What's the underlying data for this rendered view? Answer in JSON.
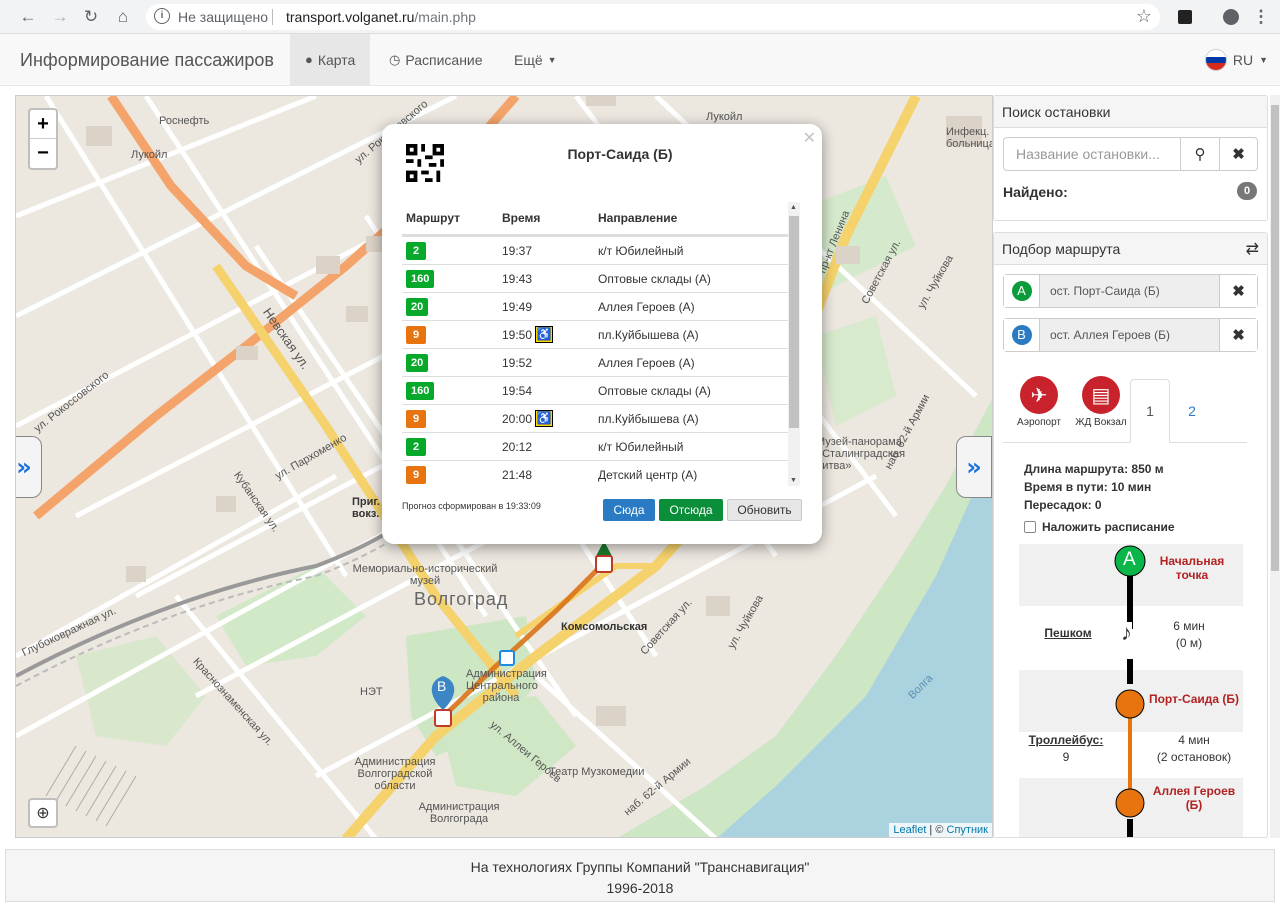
{
  "browser": {
    "security_label": "Не защищено",
    "url_host": "transport.volganet.ru",
    "url_path": "/main.php"
  },
  "nav": {
    "brand": "Информирование пассажиров",
    "map": "Карта",
    "schedule": "Расписание",
    "more": "Ещё",
    "lang": "RU"
  },
  "map": {
    "attribution_leaflet": "Leaflet",
    "attribution_sep": " | © ",
    "attribution_sputnik": "Спутник",
    "city": "Волгоград",
    "labels": {
      "rosneft": "Роснефть",
      "lukoil1": "Лукойл",
      "lukoil2": "Лукойл",
      "nevskaya": "Невская ул.",
      "rokossovskogo1": "ул. Рокоссовского",
      "rokossovskogo2": "ул. Рокоссовского",
      "komsomolskaya": "Комсомольская",
      "memorial": "Мемориально-исторический музей",
      "admin_center": "Администрация Центрального района",
      "admin_oblast": "Администрация Волгоградской области",
      "admin_city": "Администрация Волгограда",
      "teatr": "Театр Музкомедии",
      "net": "НЭТ",
      "nab62": "наб. 62-й Армии",
      "sovetskaya": "Советская ул.",
      "chuykova": "ул. Чуйкова",
      "lenina": "пр-кт Ленина",
      "volga": "Волга",
      "allei_geroev": "ул. Аллеи Героев",
      "kubanskaya": "Кубанская ул.",
      "parkhomenko": "ул. Пархоменко",
      "glubokovrazhnaya": "Глубоковражная ул.",
      "krasnoznamenskaya": "Краснознаменская ул.",
      "infect": "Инфекц. больница",
      "panorama": "Музей-панорама «Сталинградская битва»",
      "prig_vokzal": "Приг. вокз.",
      "marker_b": "B"
    }
  },
  "popup": {
    "title": "Порт-Саида (Б)",
    "columns": [
      "Маршрут",
      "Время",
      "Направление"
    ],
    "rows": [
      {
        "route": "2",
        "color": "#07a92a",
        "time": "19:37",
        "dir": "к/т Юбилейный",
        "wc": false
      },
      {
        "route": "160",
        "color": "#07a92a",
        "time": "19:43",
        "dir": "Оптовые склады (А)",
        "wc": false
      },
      {
        "route": "20",
        "color": "#07a92a",
        "time": "19:49",
        "dir": "Аллея Героев (А)",
        "wc": false
      },
      {
        "route": "9",
        "color": "#e8740f",
        "time": "19:50",
        "dir": "пл.Куйбышева (А)",
        "wc": true
      },
      {
        "route": "20",
        "color": "#07a92a",
        "time": "19:52",
        "dir": "Аллея Героев (А)",
        "wc": false
      },
      {
        "route": "160",
        "color": "#07a92a",
        "time": "19:54",
        "dir": "Оптовые склады (А)",
        "wc": false
      },
      {
        "route": "9",
        "color": "#e8740f",
        "time": "20:00",
        "dir": "пл.Куйбышева (А)",
        "wc": true
      },
      {
        "route": "2",
        "color": "#07a92a",
        "time": "20:12",
        "dir": "к/т Юбилейный",
        "wc": false
      },
      {
        "route": "9",
        "color": "#e8740f",
        "time": "21:48",
        "dir": "Детский центр (А)",
        "wc": false
      }
    ],
    "forecast": "Прогноз сформирован в 19:33:09",
    "btn_to": "Сюда",
    "btn_from": "Отсюда",
    "btn_refresh": "Обновить"
  },
  "stop_search": {
    "header": "Поиск остановки",
    "placeholder": "Название остановки...",
    "found_label": "Найдено:",
    "found_count": "0"
  },
  "route_pick": {
    "header": "Подбор маршрута",
    "point_a_letter": "A",
    "point_a": "ост. Порт-Саида (Б)",
    "point_b_letter": "B",
    "point_b": "ост. Аллея Героев (Б)",
    "quick_airport": "Аэропорт",
    "quick_station": "ЖД Вокзал",
    "tab1": "1",
    "tab2": "2",
    "length": "Длина маршрута: 850 м",
    "duration": "Время в пути: 10 мин",
    "transfers": "Пересадок: 0",
    "overlay_schedule": "Наложить расписание",
    "start_label": "Начальная точка",
    "walk_label": "Пешком",
    "walk_time": "6 мин",
    "walk_dist": "(0 м)",
    "stop1": "Порт-Саида (Б)",
    "transport_label": "Троллейбус:",
    "transport_route": "9",
    "transport_time": "4 мин",
    "transport_stops": "(2 остановок)",
    "stop2": "Аллея Героев (Б)"
  },
  "footer": {
    "line1": "На технологиях Группы Компаний \"Транснавигация\"",
    "line2": "1996-2018"
  },
  "colors": {
    "green": "#07a92a",
    "orange": "#e8740f",
    "primary": "#2a7bc4",
    "success": "#0a8e3a",
    "red_icon": "#c8232c"
  }
}
